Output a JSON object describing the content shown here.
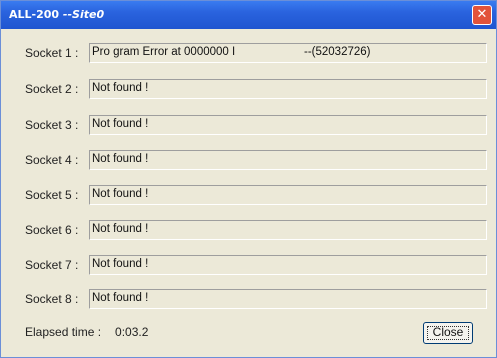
{
  "window": {
    "title_prefix": "ALL-200",
    "title_site": "--Site0"
  },
  "sockets": [
    {
      "label": "Socket 1 :",
      "status": "Pro gram Error at 0000000 I",
      "code": "--(52032726)"
    },
    {
      "label": "Socket 2 :",
      "status": "Not found !"
    },
    {
      "label": "Socket 3 :",
      "status": "Not found !"
    },
    {
      "label": "Socket 4 :",
      "status": "Not found !"
    },
    {
      "label": "Socket 5 :",
      "status": "Not found !"
    },
    {
      "label": "Socket 6 :",
      "status": "Not found !"
    },
    {
      "label": "Socket 7 :",
      "status": "Not found !"
    },
    {
      "label": "Socket 8 :",
      "status": "Not found !"
    }
  ],
  "footer": {
    "elapsed_label": "Elapsed time :",
    "elapsed_value": "0:03.2",
    "close_label": "Close"
  },
  "colors": {
    "titlebar": "#2a63de",
    "window_bg": "#ece9d8",
    "close_x": "#e2533a"
  }
}
